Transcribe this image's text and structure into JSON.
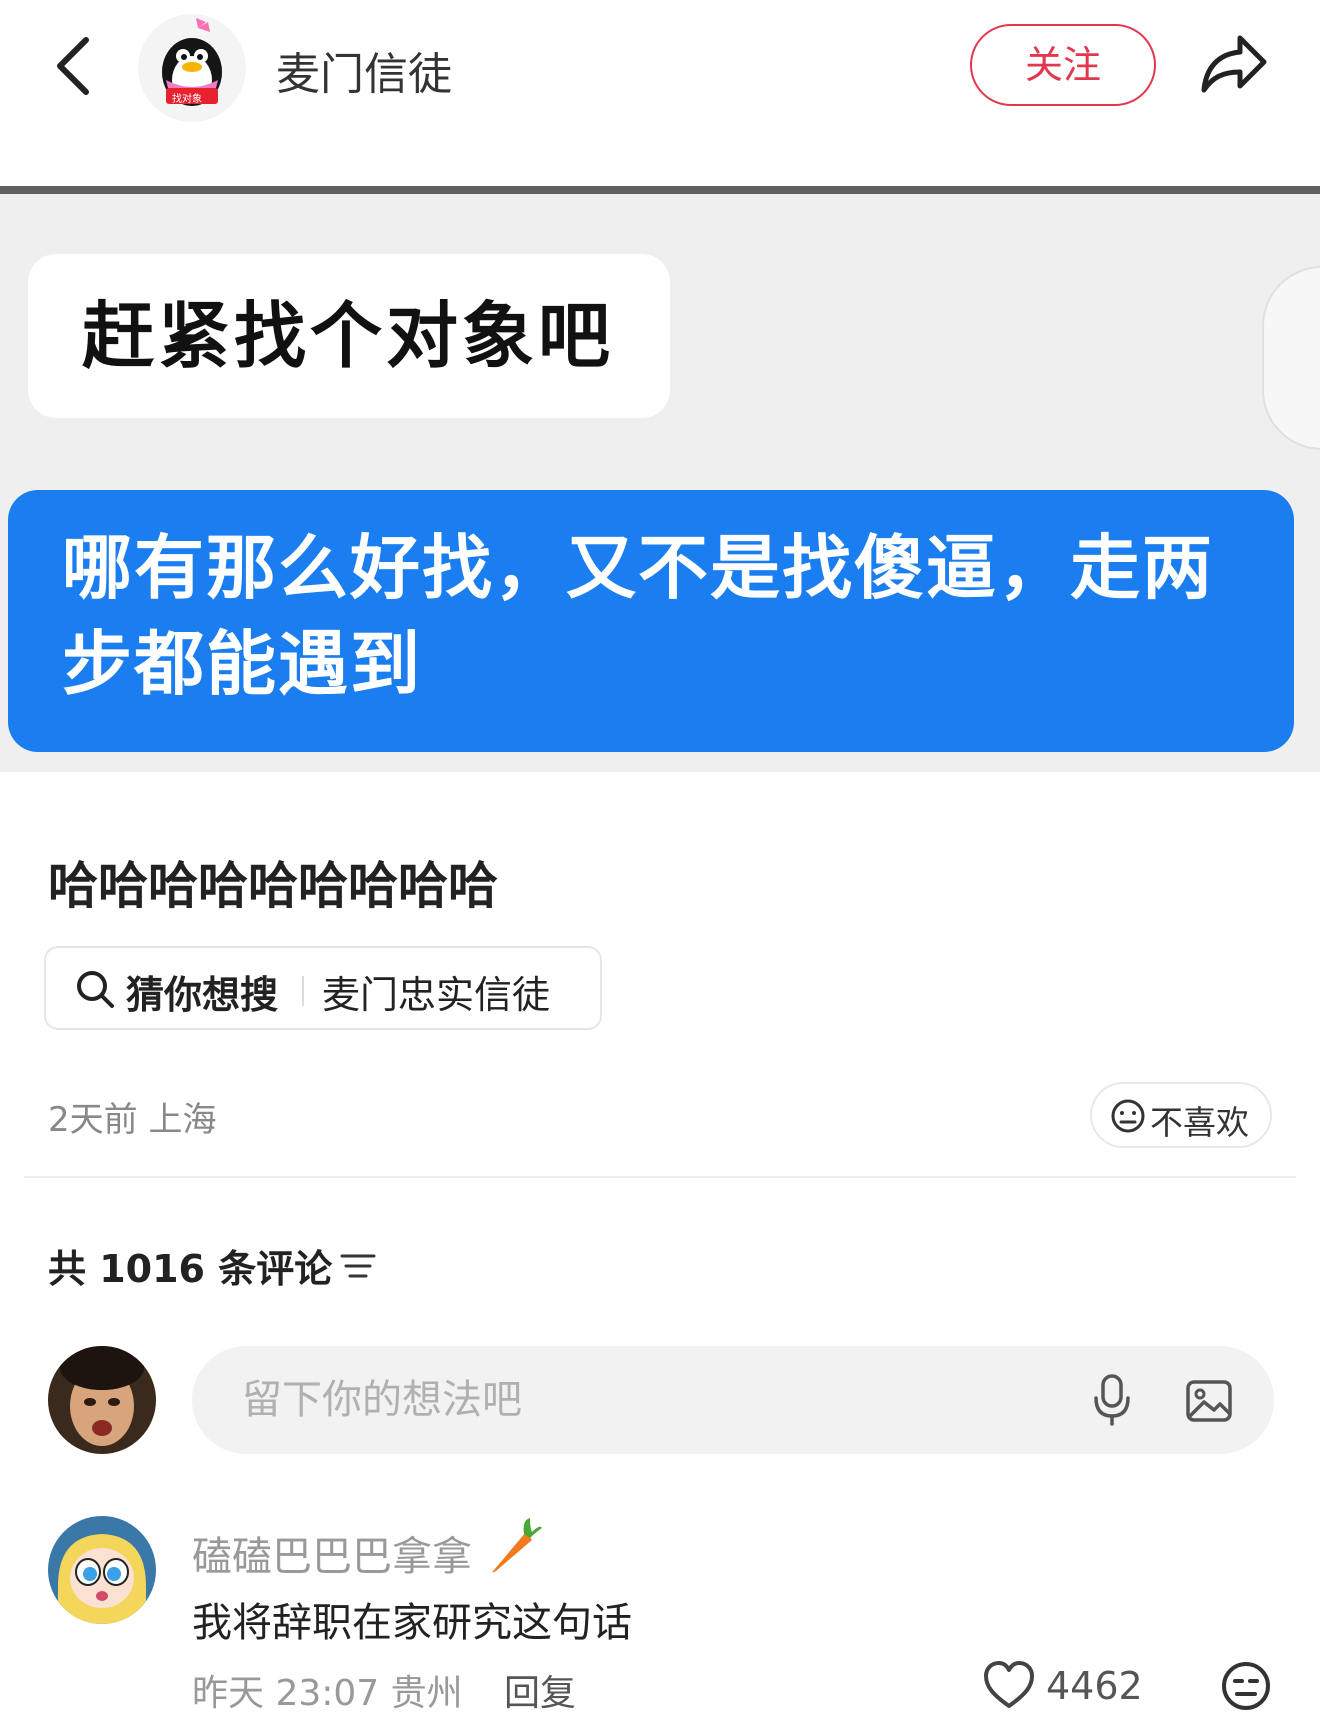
{
  "header": {
    "author_name": "麦门信徒",
    "avatar_badge": "找对象",
    "follow_label": "关注"
  },
  "image": {
    "bubble_left_text": "赶紧找个对象吧",
    "bubble_right_line1": "哪有那么好找，又不是找傻逼，走两",
    "bubble_right_line2": "步都能遇到",
    "bubble_right_color": "#1a7ef0"
  },
  "post": {
    "title": "哈哈哈哈哈哈哈哈哈",
    "search_chip_label": "猜你想搜",
    "search_chip_query": "麦门忠实信徒",
    "meta": "2天前 上海",
    "dislike_label": "不喜欢"
  },
  "comments": {
    "heading": "共 1016 条评论",
    "input_placeholder": "留下你的想法吧",
    "items": [
      {
        "name": "磕磕巴巴巴拿拿",
        "text": "我将辞职在家研究这句话",
        "time_location": "昨天 23:07 贵州",
        "reply_label": "回复",
        "likes": "4462"
      }
    ]
  },
  "colors": {
    "accent_red": "#e2384d",
    "chat_blue": "#1a7ef0"
  },
  "icons": {
    "back": "chevron-left-icon",
    "share": "share-arrow-icon",
    "search": "search-icon",
    "dislike": "neutral-face-icon",
    "sort": "sort-lines-icon",
    "mic": "microphone-icon",
    "image": "image-icon",
    "like": "heart-icon",
    "emoji": "emoji-face-icon",
    "carrot": "carrot-icon"
  }
}
